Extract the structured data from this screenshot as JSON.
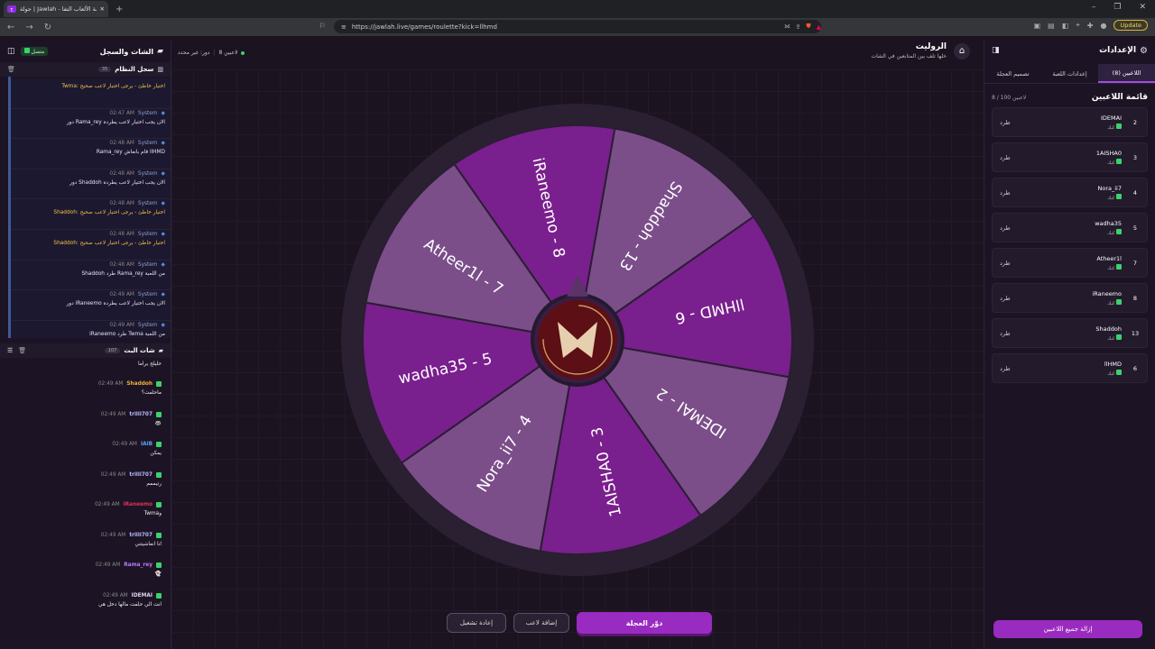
{
  "browser": {
    "tab_title": "جولة | Jawlah - منصة الألعاب التفا",
    "tab_icon": "jawlah-favicon",
    "url": "https://jawlah.live/games/roulette?kick=llhmd",
    "update_label": "Update"
  },
  "left": {
    "title": "الشات والسجل",
    "connected": "متصل",
    "syslog": {
      "title": "سجل النظام",
      "count": "35",
      "items": [
        {
          "sender": "",
          "time": "",
          "msg": "Twma: اختيار خاطئ - يرجى اختيار لاعب صحيح",
          "warn": true
        },
        {
          "sender": "System",
          "time": "02:47 AM",
          "msg": "دور Rama_rey الان يجب اختيار لاعب يطرده",
          "warn": false
        },
        {
          "sender": "System",
          "time": "02:48 AM",
          "msg": "Rama_rey قام بانعاش llHMD",
          "warn": false
        },
        {
          "sender": "System",
          "time": "02:48 AM",
          "msg": "دور Shaddoh الان يجب اختيار لاعب يطرده",
          "warn": false
        },
        {
          "sender": "System",
          "time": "02:48 AM",
          "msg": "Shaddoh: اختيار خاطئ - يرجى اختيار لاعب صحيح",
          "warn": true
        },
        {
          "sender": "System",
          "time": "02:48 AM",
          "msg": "Shaddoh: اختيار خاطئ - يرجى اختيار لاعب صحيح",
          "warn": true
        },
        {
          "sender": "System",
          "time": "02:48 AM",
          "msg": "Shaddoh طرد Rama_rey من اللعبة",
          "warn": false
        },
        {
          "sender": "System",
          "time": "02:49 AM",
          "msg": "دور iRaneemo الان يجب اختيار لاعب يطرده",
          "warn": false
        },
        {
          "sender": "System",
          "time": "02:49 AM",
          "msg": "iRaneemo طرد Twma من اللعبة",
          "warn": false
        }
      ]
    },
    "chat": {
      "title": "شات البث",
      "count": "107",
      "items": [
        {
          "user": "",
          "time": "",
          "msg": "حليلج يراما",
          "ucolor": "#e0d0f0"
        },
        {
          "user": "Shaddoh",
          "time": "02:49 AM",
          "msg": "ماحلفت؟",
          "ucolor": "#f0b33a"
        },
        {
          "user": "trilli707",
          "time": "02:49 AM",
          "msg": "🦝",
          "ucolor": "#b8b8ff"
        },
        {
          "user": "IAlB",
          "time": "02:49 AM",
          "msg": "يمكن",
          "ucolor": "#5aa0ff"
        },
        {
          "user": "trilli707",
          "time": "02:49 AM",
          "msg": "رتيممم",
          "ucolor": "#b8b8ff"
        },
        {
          "user": "iRaneemo",
          "time": "02:49 AM",
          "msg": "Twmaو",
          "ucolor": "#e0305a"
        },
        {
          "user": "trilli707",
          "time": "02:49 AM",
          "msg": "انا انعاشيتني",
          "ucolor": "#b8b8ff"
        },
        {
          "user": "Rama_rey",
          "time": "02:49 AM",
          "msg": "👻",
          "ucolor": "#b87aff"
        },
        {
          "user": "IDEMAI",
          "time": "02:49 AM",
          "msg": "انت الي حلفت مالها دخل هي",
          "ucolor": "#e0d0f0"
        }
      ]
    }
  },
  "top": {
    "player_count": "8 لاعبين",
    "turn": "دور: غير محدد",
    "title": "الروليت",
    "subtitle": "خلها تلف بين المتابعين في الشات"
  },
  "wheel": {
    "segments": [
      "Shaddoh - 13",
      "llHMD - 6",
      "IDEMAI - 2",
      "1AISHA0 - 3",
      "Nora_ii7 - 4",
      "wadha35 - 5",
      "Atheer1l - 7",
      "iRaneemo - 8"
    ],
    "colors": [
      "#7b4e8a",
      "#7a1f8e"
    ]
  },
  "buttons": {
    "spin": "دوّر العجلة",
    "add": "إضافة لاعب",
    "restart": "إعادة تشغيل"
  },
  "right": {
    "title": "الإعدادات",
    "tabs": [
      "اللاعبين (8)",
      "إعدادات اللعبة",
      "تصميم العجلة"
    ],
    "list_title": "قائمة اللاعبين",
    "list_count": "8 / 100 لاعبين",
    "kick": "طرد",
    "sub": "كيك",
    "players": [
      {
        "num": "2",
        "name": "IDEMAI"
      },
      {
        "num": "3",
        "name": "1AISHA0"
      },
      {
        "num": "4",
        "name": "Nora_ii7"
      },
      {
        "num": "5",
        "name": "wadha35"
      },
      {
        "num": "7",
        "name": "Atheer1l"
      },
      {
        "num": "8",
        "name": "iRaneemo"
      },
      {
        "num": "13",
        "name": "Shaddoh"
      },
      {
        "num": "6",
        "name": "llHMD"
      }
    ],
    "remove_all": "إزالة جميع اللاعبين"
  }
}
